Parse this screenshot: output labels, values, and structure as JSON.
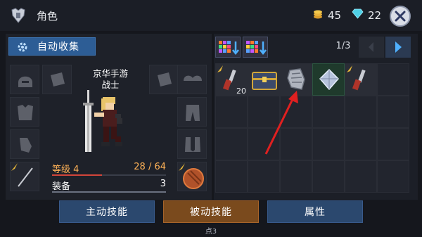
{
  "header": {
    "title": "角色",
    "gold_count": "45",
    "gem_count": "22",
    "title_icon": "armor-icon",
    "close_icon": "close-icon"
  },
  "left_panel": {
    "auto_collect_label": "自动收集",
    "character_name": "京华手游",
    "character_class": "战士",
    "level_label": "等级 4",
    "xp_text": "28 / 64",
    "xp_fraction": 0.4375,
    "equip_label": "装备",
    "equip_value": "3",
    "slots_left": [
      "helmet-icon",
      "bracer-icon",
      "chest-armor-icon",
      "gauntlet-icon",
      "spear-weapon-icon"
    ],
    "slots_right": [
      "bracer-icon",
      "shoulder-icon",
      "pants-icon",
      "boots-icon",
      "round-shield-icon"
    ]
  },
  "inventory": {
    "page": "1/3",
    "items": [
      {
        "icon": "dagger-icon",
        "count": "20"
      },
      {
        "icon": "treasure-chest-icon",
        "count": ""
      },
      {
        "icon": "gauntlet-icon",
        "count": ""
      },
      {
        "icon": "crystal-gem-icon",
        "count": ""
      },
      {
        "icon": "dagger-icon",
        "count": ""
      }
    ]
  },
  "tabs": {
    "active_skills": "主动技能",
    "passive_skills": "被动技能",
    "attributes": "属性",
    "points": "点3"
  },
  "colors": {
    "accent_blue": "#2d5d95",
    "active_tab": "#7a4a1d",
    "xp_bar": "#d2453a",
    "highlight_arrow": "#e02020"
  }
}
